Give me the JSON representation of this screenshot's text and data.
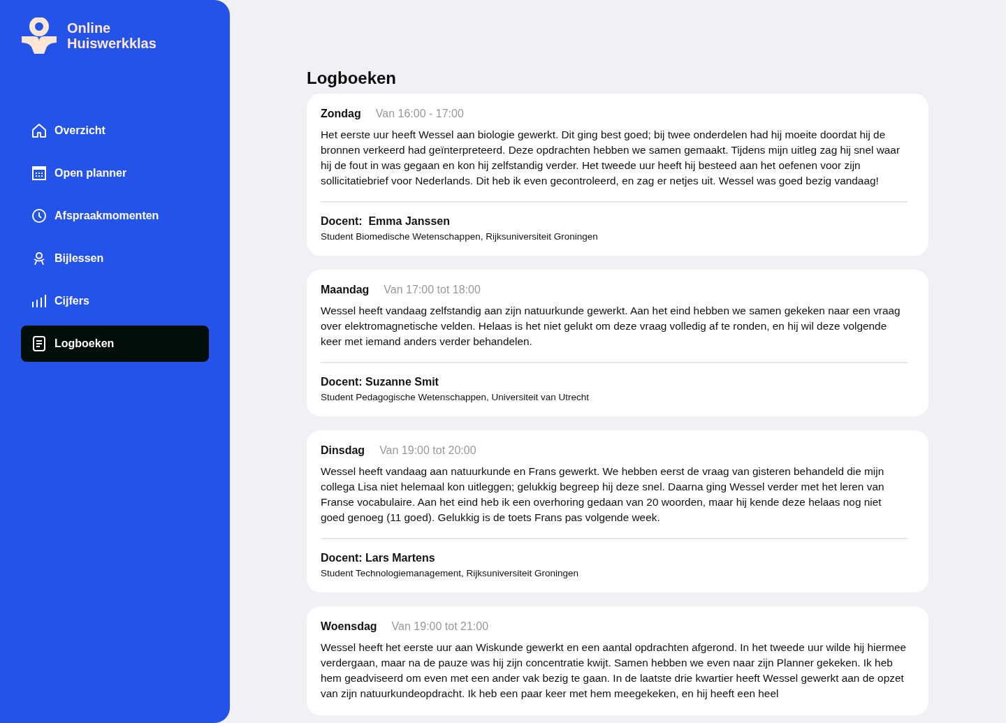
{
  "brand": {
    "line1": "Online",
    "line2": "Huiswerkklas"
  },
  "nav": [
    {
      "label": "Overzicht",
      "selected": false
    },
    {
      "label": "Open planner",
      "selected": false
    },
    {
      "label": "Afspraakmomenten",
      "selected": false
    },
    {
      "label": "Bijlessen",
      "selected": false
    },
    {
      "label": "Cijfers",
      "selected": false
    },
    {
      "label": "Logboeken",
      "selected": true
    }
  ],
  "page_title": "Logboeken",
  "entries": [
    {
      "day": "Zondag",
      "time": "Van 16:00 - 17:00",
      "text": "Het eerste uur heeft Wessel aan biologie gewerkt. Dit ging best goed; bij twee onderdelen had hij moeite doordat hij de bronnen verkeerd had geïnterpreteerd. Deze opdrachten hebben we samen gemaakt. Tijdens mijn uitleg zag hij snel waar hij de fout in was gegaan en kon hij zelfstandig verder. Het tweede uur heeft hij besteed aan het oefenen voor zijn sollicitatiebrief voor Nederlands. Dit heb ik even gecontroleerd, en zag er netjes uit. Wessel was goed bezig vandaag!",
      "teacher": "Docent:  Emma Janssen",
      "affiliation": "Student Biomedische Wetenschappen, Rijksuniversiteit Groningen"
    },
    {
      "day": "Maandag",
      "time": "Van 17:00 tot 18:00",
      "text": "Wessel heeft vandaag zelfstandig aan zijn natuurkunde gewerkt. Aan het eind hebben we samen gekeken naar een vraag over elektromagnetische velden. Helaas is het niet gelukt om deze vraag volledig af te ronden, en hij wil deze volgende keer met iemand anders verder behandelen.",
      "teacher": "Docent: Suzanne Smit",
      "affiliation": "Student Pedagogische Wetenschappen, Universiteit van Utrecht"
    },
    {
      "day": "Dinsdag",
      "time": "Van 19:00 tot 20:00",
      "text": "Wessel heeft vandaag aan natuurkunde en Frans gewerkt. We hebben eerst de vraag van gisteren behandeld die mijn collega Lisa niet helemaal kon uitleggen; gelukkig begreep hij deze snel. Daarna ging Wessel verder met het leren van Franse vocabulaire. Aan het eind heb ik een overhoring gedaan van 20 woorden, maar hij kende deze helaas nog niet goed genoeg (11 goed). Gelukkig is de toets Frans pas volgende week.",
      "teacher": "Docent: Lars Martens",
      "affiliation": "Student Technologiemanagement, Rijksuniversiteit Groningen"
    },
    {
      "day": "Woensdag",
      "time": "Van 19:00 tot 21:00",
      "text": "Wessel heeft het eerste uur aan Wiskunde gewerkt en een aantal opdrachten afgerond. In het tweede uur wilde hij hiermee verdergaan, maar na de pauze was hij zijn concentratie kwijt. Samen hebben we even naar zijn Planner gekeken. Ik heb hem geadviseerd om even met een ander vak bezig te gaan. In de laatste drie kwartier heeft Wessel gewerkt aan de opzet van zijn natuurkundeopdracht. Ik heb een paar keer met hem meegekeken, en hij heeft een heel"
    }
  ]
}
